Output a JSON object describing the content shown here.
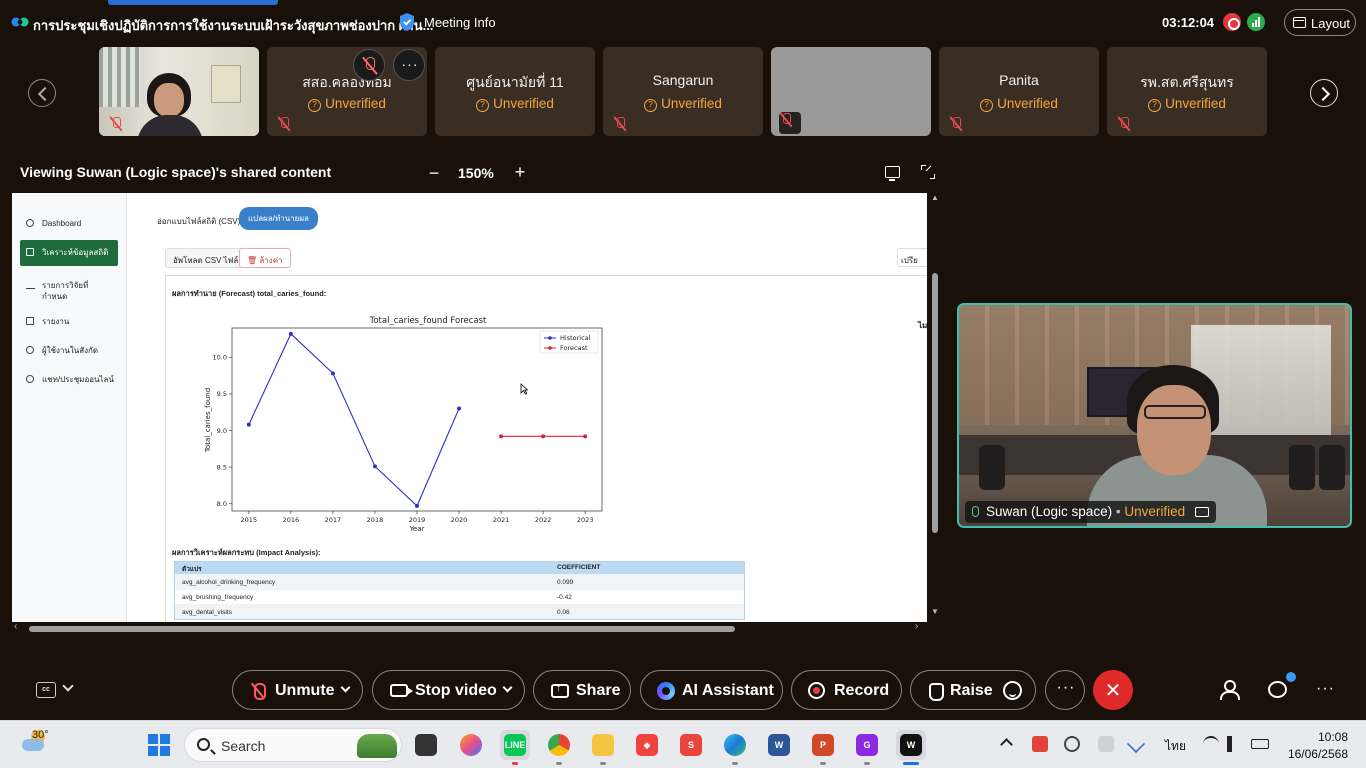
{
  "titlebar": {
    "title": "การประชุมเชิงปฏิบัติการการใช้งานระบบเฝ้าระวังสุขภาพช่องปาก ผ่าน...",
    "meeting_info": "Meeting Info",
    "clock": "03:12:04",
    "layout_label": "Layout"
  },
  "participants": [
    {
      "name": "",
      "status": "",
      "type": "video"
    },
    {
      "name": "สสอ.คลองท่อม",
      "status": "Unverified",
      "type": "name"
    },
    {
      "name": "ศูนย์อนามัยที่ 11",
      "status": "Unverified",
      "type": "name"
    },
    {
      "name": "Sangarun",
      "status": "Unverified",
      "type": "name"
    },
    {
      "name": "",
      "status": "",
      "type": "blank"
    },
    {
      "name": "Panita",
      "status": "Unverified",
      "type": "name"
    },
    {
      "name": "รพ.สต.ศรีสุนทร",
      "status": "Unverified",
      "type": "name"
    }
  ],
  "share_header": {
    "title": "Viewing Suwan (Logic space)'s shared content",
    "zoom_minus": "−",
    "zoom_level": "150%",
    "zoom_plus": "+"
  },
  "shared_app": {
    "sidebar": [
      {
        "label": "Dashboard",
        "icon": "clock-icon"
      },
      {
        "label": "วิเคราะห์ข้อมูลสถิติ",
        "icon": "chart-icon"
      },
      {
        "label": "รายการวิจัยที่กำหนด",
        "icon": "pulse-icon"
      },
      {
        "label": "รายงาน",
        "icon": "document-icon"
      },
      {
        "label": "ผู้ใช้งานในสังกัด",
        "icon": "users-icon"
      },
      {
        "label": "แชท/ประชุมออนไลน์",
        "icon": "chat-icon"
      }
    ],
    "tabs": [
      "อ่อกแบบไฟล์สถิติ (CSV)",
      "แปลผล/ทำนายผล"
    ],
    "upload_btn": "อัพโหลด CSV ไฟล์",
    "clear_btn": "ล้างค่า",
    "right_btn": "เปรีย",
    "right_hint": "ไม",
    "forecast_heading": "ผลการทำนาย (Forecast) total_caries_found:",
    "impact_heading": "ผลการวิเคราะห์ผลกระทบ (Impact Analysis):",
    "impact_table": {
      "headers": [
        "ตัวแปร",
        "COEFFICIENT"
      ],
      "rows": [
        [
          "avg_alcohol_drinking_frequency",
          "0.099"
        ],
        [
          "avg_brushing_frequency",
          "-0.42"
        ],
        [
          "avg_dental_visits",
          "0.06"
        ]
      ]
    }
  },
  "chart_data": {
    "type": "line",
    "title": "Total_caries_found Forecast",
    "xlabel": "Year",
    "ylabel": "Total_caries_found",
    "xlim": [
      2014.6,
      2023.4
    ],
    "ylim": [
      7.9,
      10.4
    ],
    "x_ticks": [
      2015,
      2016,
      2017,
      2018,
      2019,
      2020,
      2021,
      2022,
      2023
    ],
    "y_ticks": [
      8.0,
      8.5,
      9.0,
      9.5,
      10.0
    ],
    "legend_position": "top-right",
    "series": [
      {
        "name": "Historical",
        "color": "#2f2fd0",
        "x": [
          2015,
          2016,
          2017,
          2018,
          2019,
          2020
        ],
        "y": [
          9.08,
          10.32,
          9.78,
          8.51,
          7.97,
          9.3
        ]
      },
      {
        "name": "Forecast",
        "color": "#d0243a",
        "x": [
          2021,
          2022,
          2023
        ],
        "y": [
          8.92,
          8.92,
          8.92
        ]
      }
    ]
  },
  "self_view": {
    "name": "Suwan (Logic space)",
    "separator": "•",
    "status": "Unverified"
  },
  "controls": {
    "cc": "cc",
    "unmute": "Unmute",
    "stop_video": "Stop video",
    "share": "Share",
    "ai_assistant": "AI Assistant",
    "record": "Record",
    "raise": "Raise",
    "more": "···",
    "leave": "✕",
    "more_right": "···"
  },
  "taskbar": {
    "temperature": "30°",
    "search_placeholder": "Search",
    "language": "ไทย",
    "time": "10:08",
    "date": "16/06/2568"
  }
}
